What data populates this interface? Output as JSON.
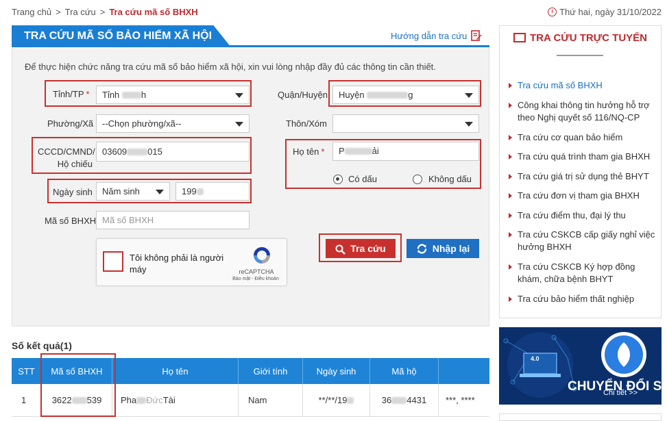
{
  "breadcrumb": {
    "home": "Trang chủ",
    "sep": ">",
    "lookup": "Tra cứu",
    "current": "Tra cứu mã số BHXH"
  },
  "date": "Thứ hai, ngày 31/10/2022",
  "panel": {
    "title": "TRA CỨU MÃ SỐ BẢO HIỂM XÃ HỘI",
    "guide": "Hướng dẫn tra cứu",
    "intro": "Để thực hiện chức năng tra cứu mã số bảo hiểm xã hội, xin vui lòng nhập đầy đủ các thông tin cần thiết."
  },
  "form": {
    "province_label": "Tỉnh/TP",
    "province_value_prefix": "Tỉnh",
    "province_value_suffix": "h",
    "district_label": "Quận/Huyện",
    "district_value_prefix": "Huyện",
    "district_value_suffix": "g",
    "ward_label": "Phường/Xã",
    "ward_value": "--Chọn phường/xã--",
    "village_label": "Thôn/Xóm",
    "village_value": "",
    "id_label_1": "CCCD/CMND/",
    "id_label_2": "Hộ chiếu",
    "id_prefix": "03609",
    "id_suffix": "015",
    "name_label": "Họ tên",
    "name_prefix": "P",
    "name_suffix": "ải",
    "accent_yes": "Có dấu",
    "accent_no": "Không dấu",
    "dob_label": "Ngày sinh",
    "dob_select": "Năm sinh",
    "dob_year_prefix": "199",
    "bhxh_label": "Mã số BHXH",
    "bhxh_placeholder": "Mã số BHXH",
    "required_mark": "*"
  },
  "captcha": {
    "text": "Tôi không phải là người máy",
    "brand": "reCAPTCHA",
    "links": "Bảo mật - Điều khoản"
  },
  "buttons": {
    "search": "Tra cứu",
    "reset": "Nhập lại"
  },
  "results": {
    "title": "Số kết quả(1)",
    "headers": [
      "STT",
      "Mã số BHXH",
      "Họ tên",
      "Giới tính",
      "Ngày sinh",
      "Mã hộ",
      ""
    ],
    "row": {
      "stt": "1",
      "bhxh_prefix": "3622",
      "bhxh_suffix": "539",
      "name_prefix": "Pha",
      "name_mid": "Đức",
      "name_suffix": "Tài",
      "gender": "Nam",
      "dob": "**/**/19",
      "household_prefix": "36",
      "household_suffix": "4431",
      "extra": "***, ****"
    }
  },
  "sidebar": {
    "title": "TRA CỨU TRỰC TUYẾN",
    "items": [
      "Tra cứu mã số BHXH",
      "Công khai thông tin hưởng hỗ trợ theo Nghị quyết số 116/NQ-CP",
      "Tra cứu cơ quan bảo hiểm",
      "Tra cứu quá trình tham gia BHXH",
      "Tra cứu giá trị sử dụng thẻ BHYT",
      "Tra cứu đơn vị tham gia BHXH",
      "Tra cứu điểm thu, đại lý thu",
      "Tra cứu CSKCB cấp giấy nghỉ việc hưởng BHXH",
      "Tra cứu CSKCB Ký hợp đồng khám, chữa bệnh BHYT",
      "Tra cứu bảo hiểm thất nghiệp"
    ]
  },
  "banner": {
    "headline": "CHUYỂN ĐỔI SỐ",
    "more": "Chi tiết >>",
    "badge": "4.0"
  },
  "colors": {
    "brand_blue": "#1a7fd4",
    "brand_red": "#c8302d",
    "reset_blue": "#1f6fc3"
  }
}
